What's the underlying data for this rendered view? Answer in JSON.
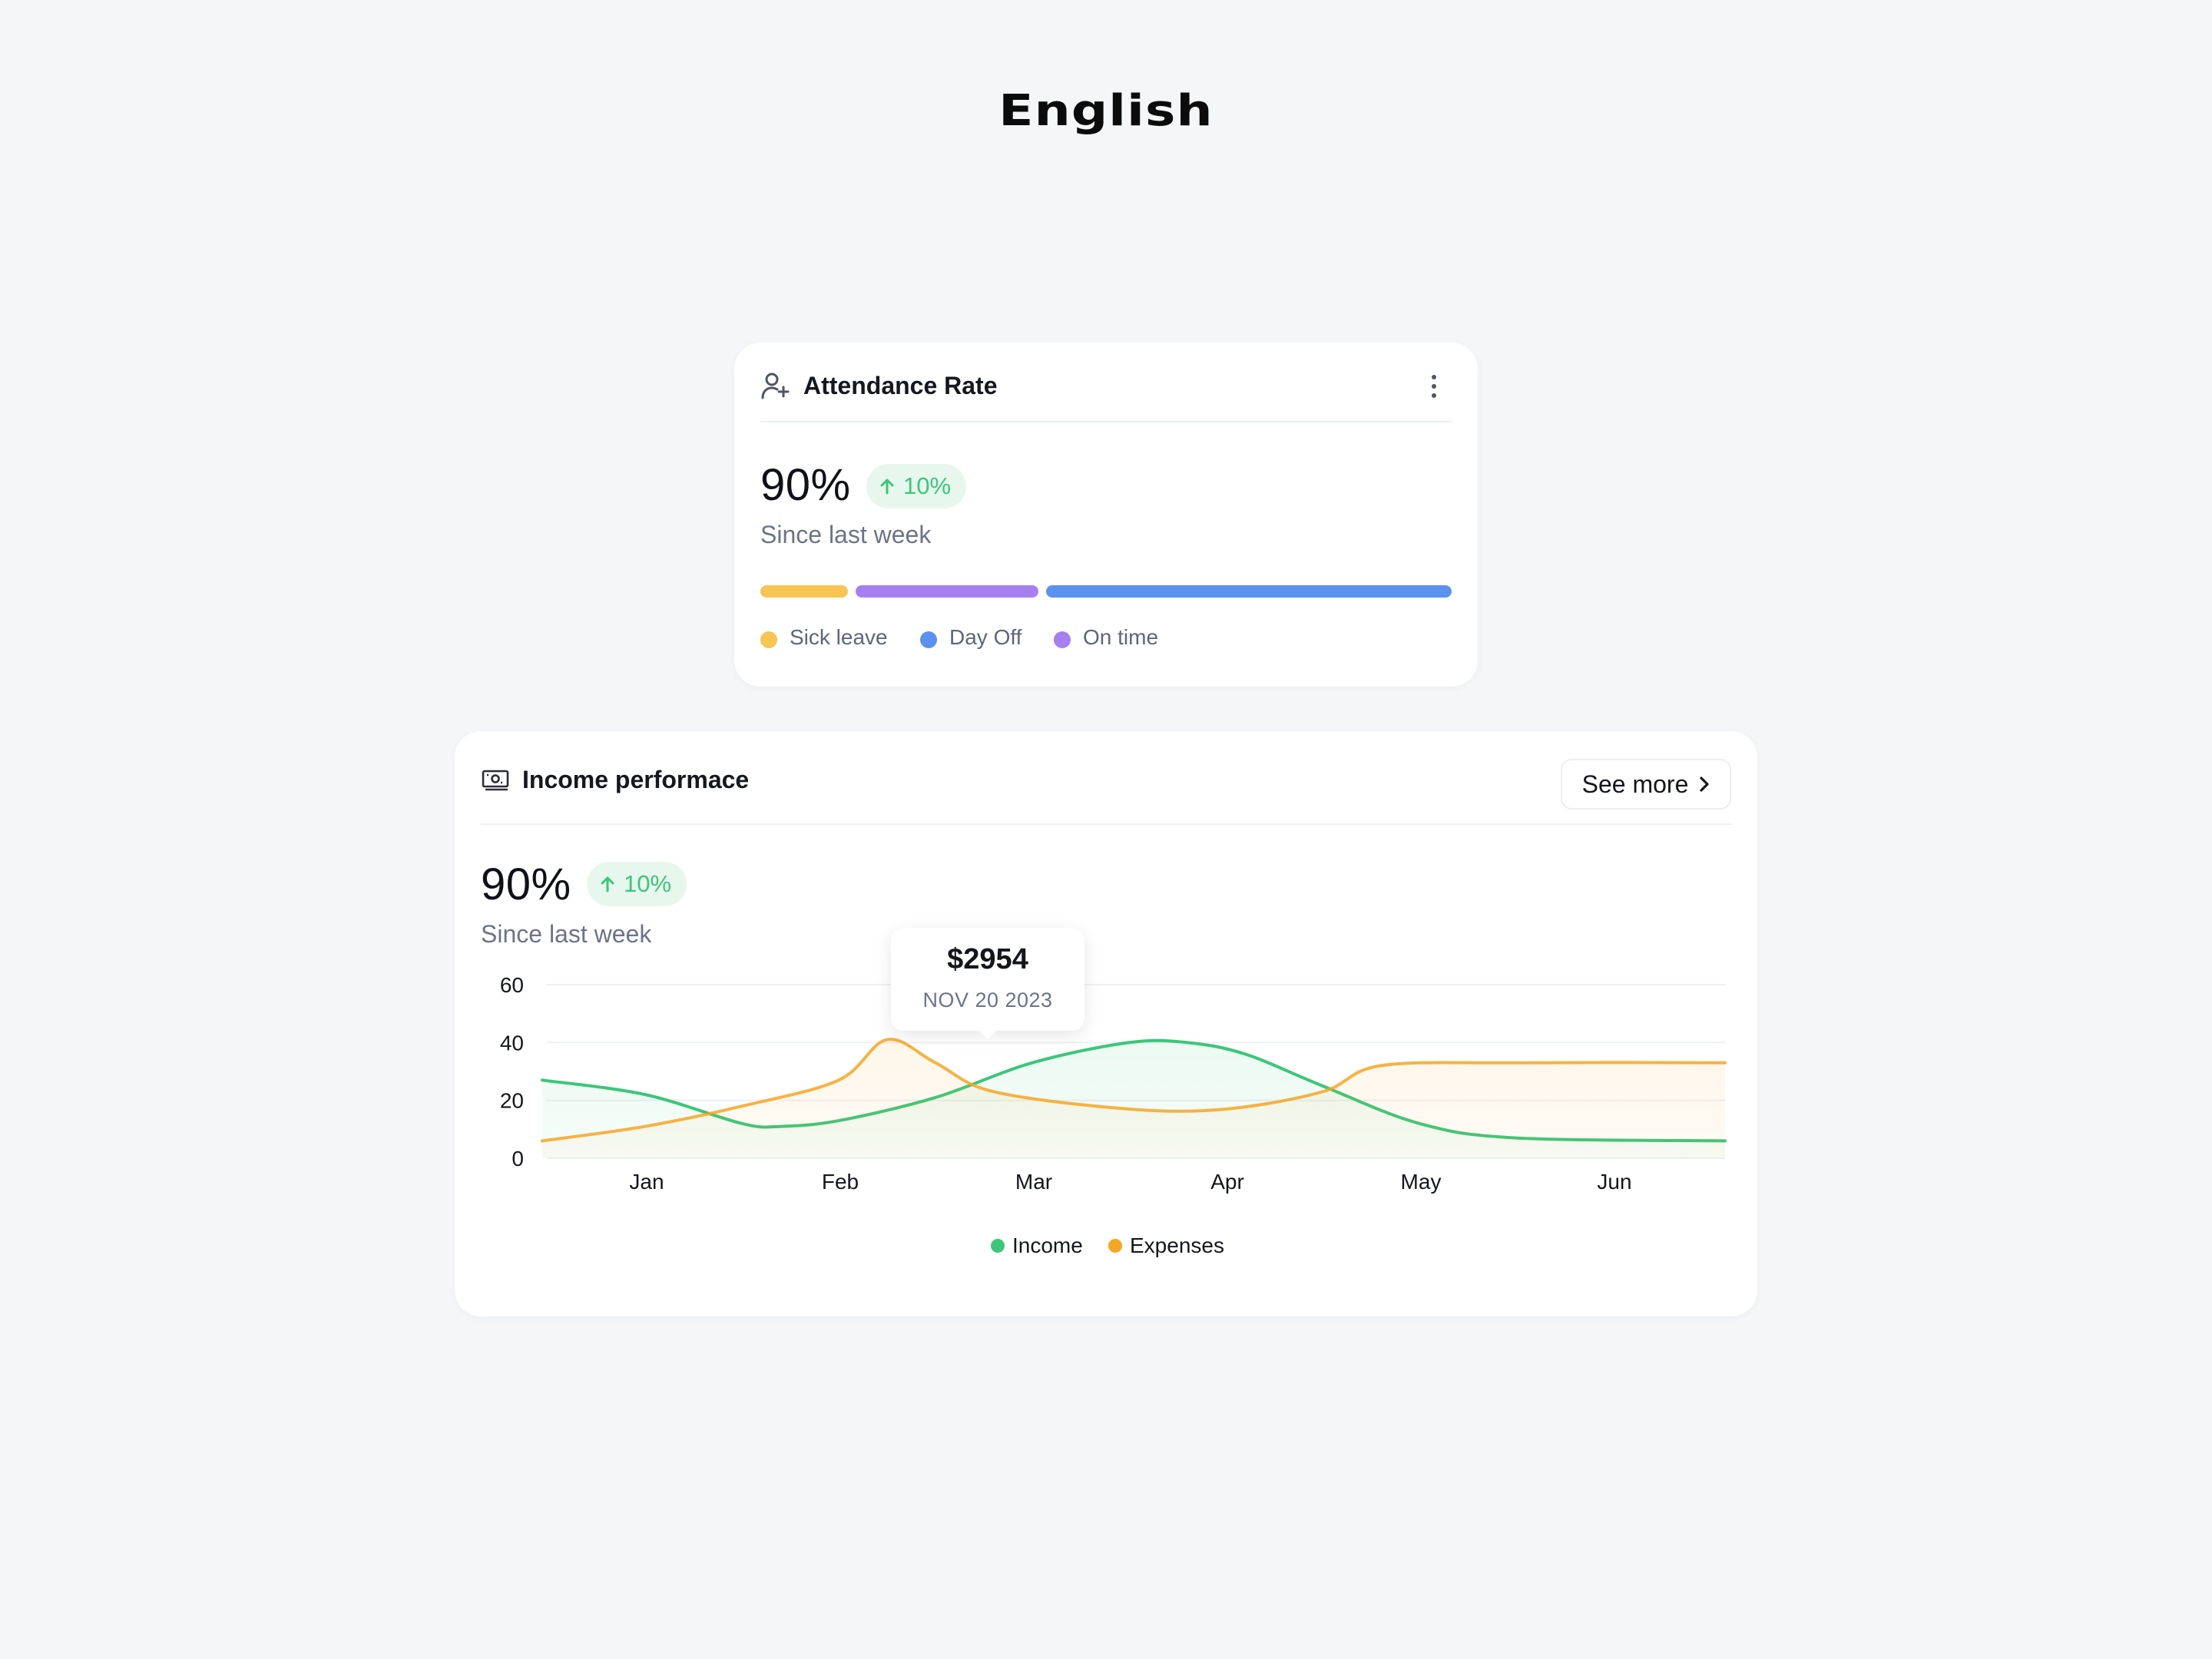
{
  "page": {
    "title": "English"
  },
  "attendance": {
    "title": "Attendance Rate",
    "value": "90%",
    "change": "10%",
    "since": "Since last week",
    "segments": [
      {
        "name": "Sick leave",
        "color": "#f8c452",
        "share": 0.13
      },
      {
        "name": "On time",
        "color": "#a67ff0",
        "share": 0.27
      },
      {
        "name": "Day Off",
        "color": "#5b91ef",
        "share": 0.6
      }
    ],
    "legend": [
      {
        "label": "Sick leave",
        "color": "#f8c452"
      },
      {
        "label": "Day Off",
        "color": "#5b91ef"
      },
      {
        "label": "On time",
        "color": "#a67ff0"
      }
    ]
  },
  "income": {
    "title": "Income performace",
    "see_more": "See more",
    "value": "90%",
    "change": "10%",
    "since": "Since last week",
    "tooltip": {
      "value": "$2954",
      "date": "NOV 20 2023"
    },
    "legend": [
      {
        "label": "Income",
        "color": "#3cc67a"
      },
      {
        "label": "Expenses",
        "color": "#f5a623"
      }
    ]
  },
  "chart_data": {
    "type": "area",
    "categories": [
      "Jan",
      "Feb",
      "Mar",
      "Apr",
      "May",
      "Jun"
    ],
    "yticks": [
      0,
      20,
      40,
      60
    ],
    "ylim": [
      0,
      60
    ],
    "grid": true,
    "legend_position": "bottom",
    "series": [
      {
        "name": "Income",
        "color": "#3cc67a",
        "points": [
          [
            0.0,
            27
          ],
          [
            0.5,
            22
          ],
          [
            1.0,
            12
          ],
          [
            1.2,
            11
          ],
          [
            1.5,
            13
          ],
          [
            2.0,
            21
          ],
          [
            2.5,
            33
          ],
          [
            3.0,
            40
          ],
          [
            3.3,
            40
          ],
          [
            3.6,
            36
          ],
          [
            4.0,
            25
          ],
          [
            4.5,
            12
          ],
          [
            5.0,
            7
          ],
          [
            5.5,
            6
          ]
        ]
      },
      {
        "name": "Expenses",
        "color": "#f5a623",
        "points": [
          [
            0.0,
            6
          ],
          [
            0.5,
            11
          ],
          [
            1.0,
            18
          ],
          [
            1.5,
            27
          ],
          [
            1.75,
            41
          ],
          [
            2.0,
            33
          ],
          [
            2.3,
            23
          ],
          [
            3.0,
            17
          ],
          [
            3.5,
            17
          ],
          [
            4.0,
            23
          ],
          [
            4.3,
            32
          ],
          [
            5.0,
            33
          ],
          [
            5.5,
            33
          ]
        ]
      }
    ]
  }
}
